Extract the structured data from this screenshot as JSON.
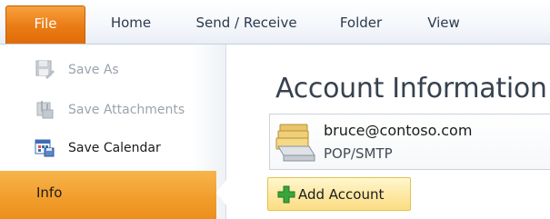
{
  "ribbon": {
    "file_label": "File",
    "tabs": [
      {
        "label": "Home"
      },
      {
        "label": "Send / Receive"
      },
      {
        "label": "Folder"
      },
      {
        "label": "View"
      }
    ]
  },
  "nav": {
    "items": [
      {
        "label": "Save As",
        "icon": "save-as-icon",
        "enabled": false
      },
      {
        "label": "Save Attachments",
        "icon": "save-attachments-icon",
        "enabled": false
      },
      {
        "label": "Save Calendar",
        "icon": "save-calendar-icon",
        "enabled": true
      }
    ],
    "selected": {
      "label": "Info"
    }
  },
  "main": {
    "heading": "Account Information",
    "account": {
      "email": "bruce@contoso.com",
      "type": "POP/SMTP",
      "icon": "account-folders-icon"
    },
    "add_account_label": "Add Account"
  },
  "colors": {
    "file_tab": "#ea7b14",
    "info_selected": "#f2a030",
    "add_button": "#fde9a6",
    "plus_green": "#3aa53a"
  }
}
